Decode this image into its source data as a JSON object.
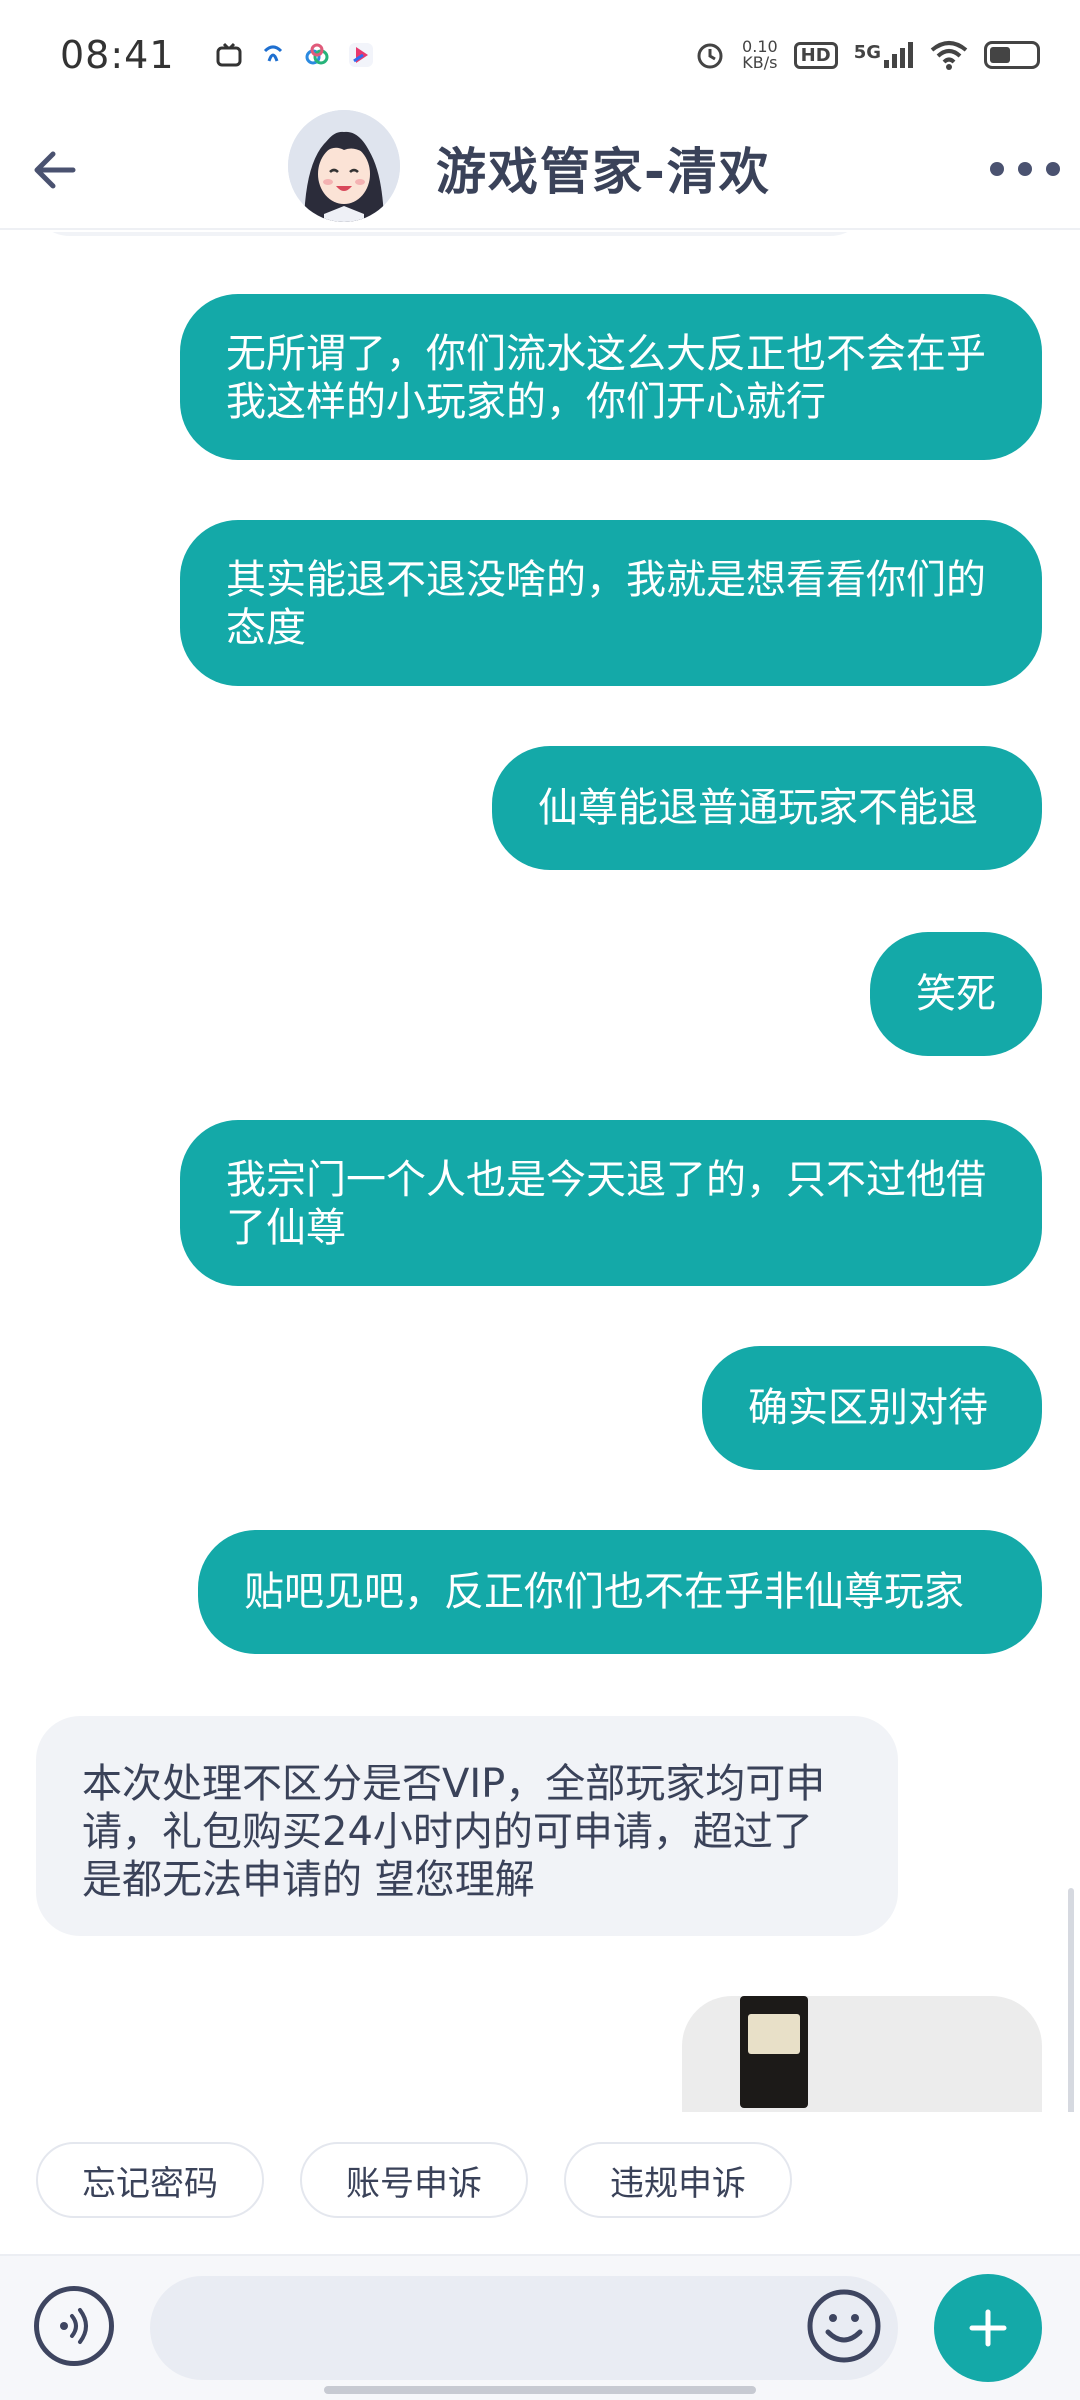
{
  "status_bar": {
    "time": "08:41",
    "net_speed_value": "0.10",
    "net_speed_unit": "KB/s",
    "hd_label": "HD",
    "signal_label": "5G"
  },
  "header": {
    "title": "游戏管家-清欢",
    "avatar_icon": "anime-girl-avatar"
  },
  "messages": [
    {
      "direction": "out",
      "text": "无所谓了，你们流水这么大反正也不会在乎我这样的小玩家的，你们开心就行"
    },
    {
      "direction": "out",
      "text": "其实能退不退没啥的，我就是想看看你们的态度"
    },
    {
      "direction": "out",
      "text": "仙尊能退普通玩家不能退"
    },
    {
      "direction": "out",
      "text": "笑死"
    },
    {
      "direction": "out",
      "text": "我宗门一个人也是今天退了的，只不过他借了仙尊"
    },
    {
      "direction": "out",
      "text": "确实区别对待"
    },
    {
      "direction": "out",
      "text": "贴吧见吧，反正你们也不在乎非仙尊玩家"
    },
    {
      "direction": "in",
      "text": "本次处理不区分是否VIP，全部玩家均可申请，礼包购买24小时内的可申请，超过了是都无法申请的 望您理解"
    }
  ],
  "quick_replies": [
    "忘记密码",
    "账号申诉",
    "违规申诉"
  ],
  "input": {
    "placeholder": ""
  },
  "colors": {
    "accent": "#14a9a8",
    "incoming_bubble": "#f1f3f7",
    "text_dark": "#3a4259"
  }
}
